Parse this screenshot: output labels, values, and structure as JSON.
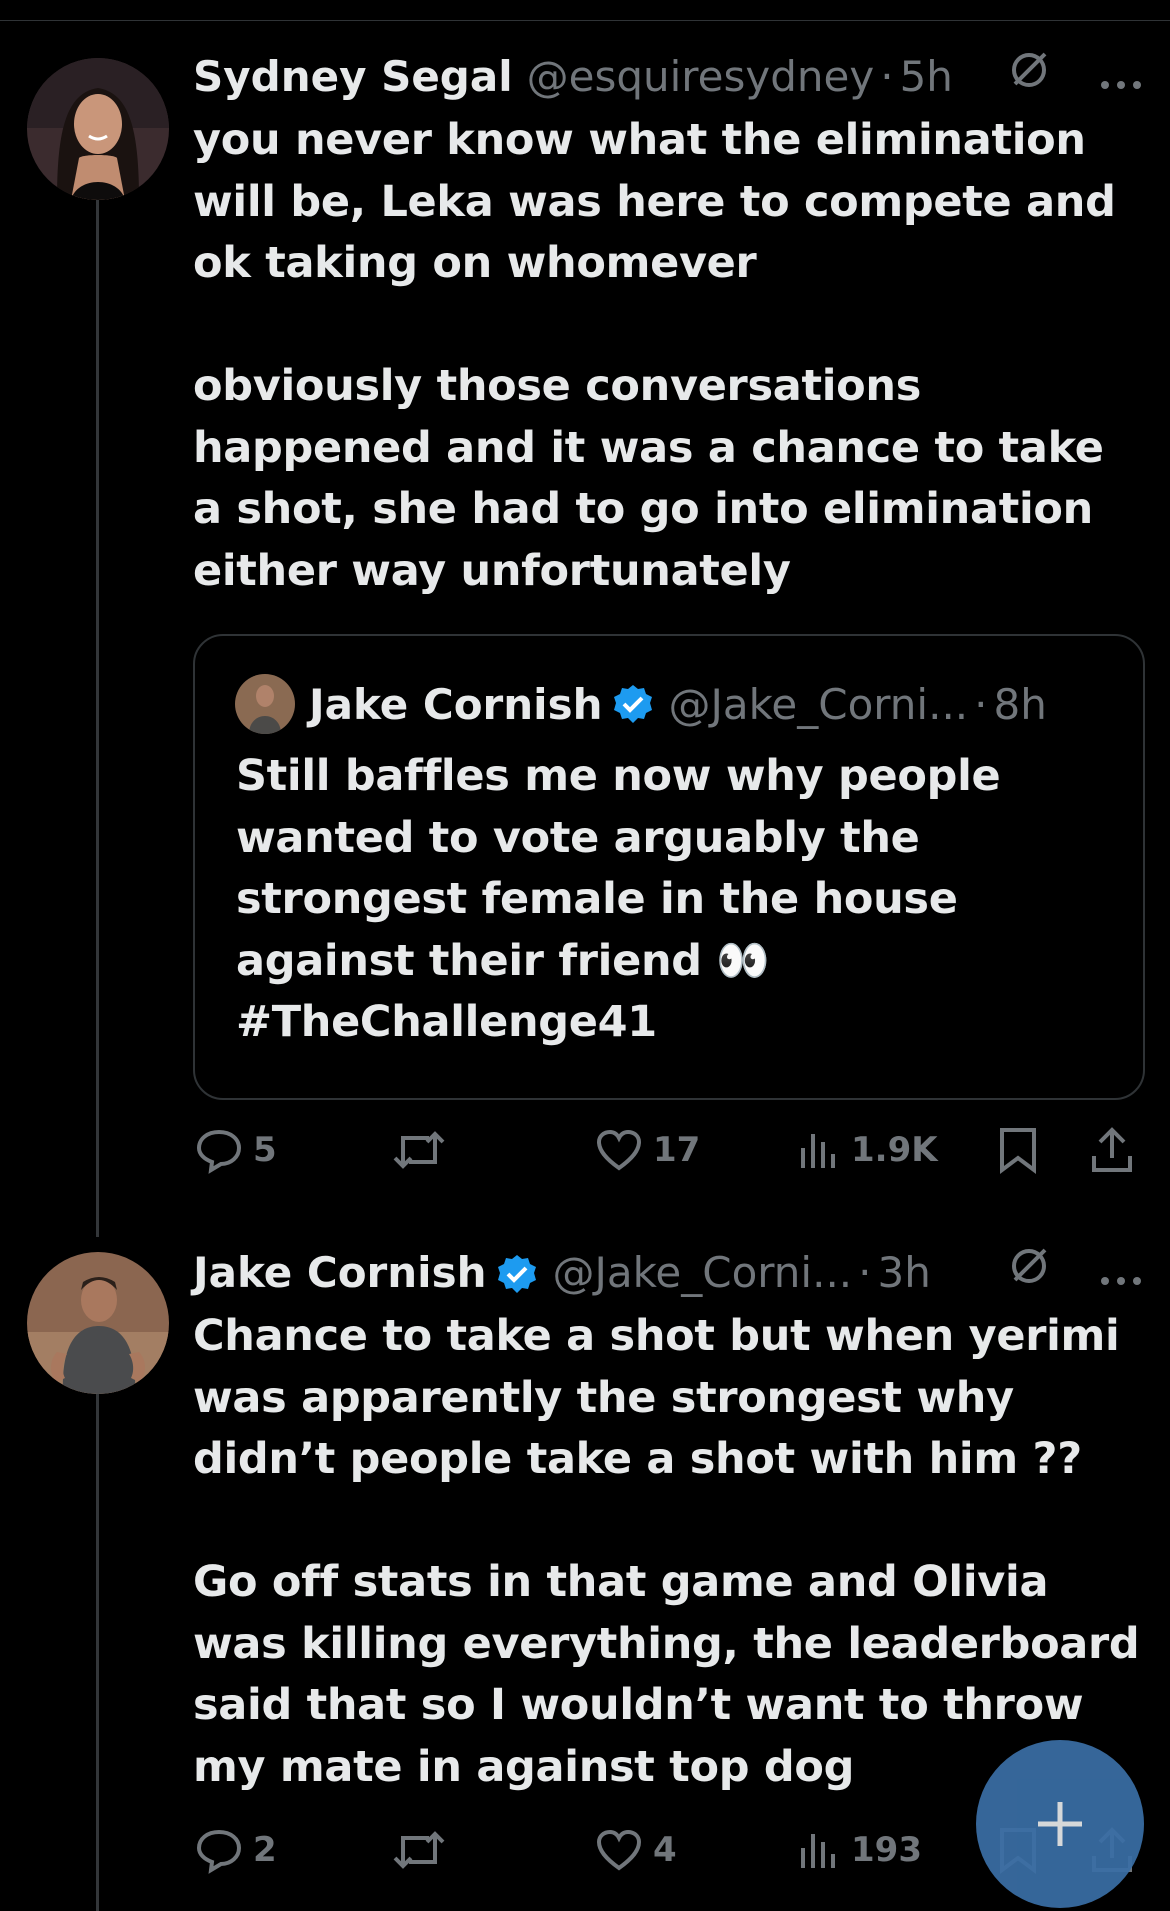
{
  "colors": {
    "background": "#000000",
    "text": "#e7e9ea",
    "muted": "#71767b",
    "verified": "#1d9bf0",
    "fab": "#3a6ea5"
  },
  "posts": [
    {
      "name": "Sydney Segal",
      "handle": "@esquiresydney",
      "separator": "·",
      "time": "5h",
      "text": "you never know what the elimination will be, Leka was here to compete and ok taking on whomever\n\nobviously those conversations happened and it was a chance to take a shot, she had to go into elimination either way unfortunately",
      "quote": {
        "name": "Jake Cornish",
        "handle": "@Jake_Corni...",
        "separator": "·",
        "time": "8h",
        "text": "Still baffles me now why people wanted to vote arguably the strongest female in the house against their friend 👀 #TheChallenge41"
      },
      "metrics": {
        "replies": "5",
        "reposts": "",
        "likes": "17",
        "views": "1.9K"
      }
    },
    {
      "name": "Jake Cornish",
      "handle": "@Jake_Corni...",
      "separator": "·",
      "time": "3h",
      "text": "Chance to take a shot but when yerimi was apparently the strongest why didn’t people take a shot with him ??\n\nGo off stats in that game and Olivia was killing everything, the leaderboard said that so I wouldn’t want to throw my mate in against top dog",
      "metrics": {
        "replies": "2",
        "reposts": "",
        "likes": "4",
        "views": "193"
      }
    }
  ],
  "icons": [
    "grok-icon",
    "more-icon",
    "verified-icon",
    "reply-icon",
    "repost-icon",
    "like-icon",
    "views-icon",
    "bookmark-icon",
    "share-icon",
    "compose-plus-icon"
  ]
}
